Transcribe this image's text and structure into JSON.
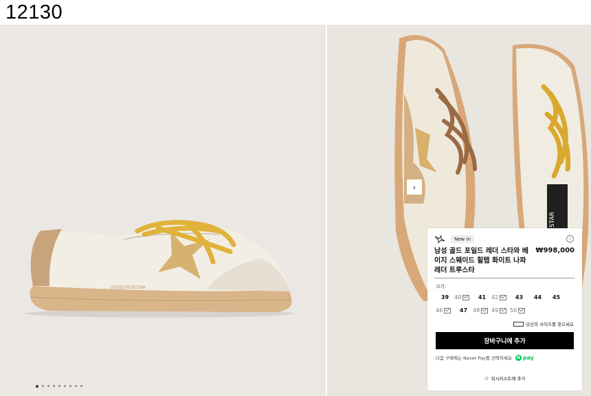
{
  "header": {
    "code": "12130"
  },
  "gallery": {
    "left_image": "sneaker-side-view",
    "right_image": "sneaker-pair-top-view",
    "dots_count": 9,
    "active_dot": 0
  },
  "card": {
    "badge": "New in",
    "product_name": "남성 골드 포일드 레더 스타와 베이지 스웨이드 힐탭 화이트 나파 레더 트루스타",
    "price": "₩998,000",
    "size_label": "크기:",
    "sizes_row1": [
      {
        "size": "39",
        "available": true
      },
      {
        "size": "40",
        "available": false
      },
      {
        "size": "41",
        "available": true
      },
      {
        "size": "42",
        "available": false
      },
      {
        "size": "43",
        "available": true
      },
      {
        "size": "44",
        "available": true
      },
      {
        "size": "45",
        "available": true
      }
    ],
    "sizes_row2": [
      {
        "size": "46",
        "available": false
      },
      {
        "size": "47",
        "available": true
      },
      {
        "size": "48",
        "available": false
      },
      {
        "size": "49",
        "available": false
      },
      {
        "size": "50",
        "available": false
      }
    ],
    "size_guide": "당신의 사이즈를 찾으세요",
    "add_to_cart": "장바구니에 추가",
    "naver_text": "다음 구매에는 Naver Pay를 선택하세요",
    "npay_label": "pay",
    "npay_letter": "N",
    "wishlist": "위시리스트에 추가"
  }
}
